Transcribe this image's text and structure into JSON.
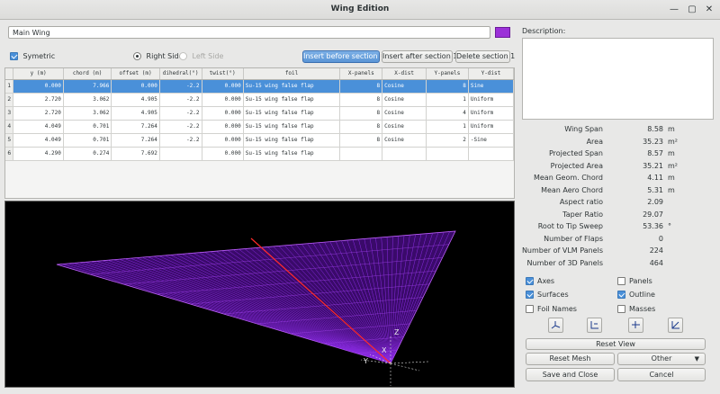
{
  "window": {
    "title": "Wing Edition",
    "minimize_glyph": "—",
    "maximize_glyph": "▢",
    "close_glyph": "✕"
  },
  "wing_name": "Main Wing",
  "wing_color": "#9b30d8",
  "symmetric": {
    "label": "Symetric",
    "checked": true
  },
  "side": {
    "right_label": "Right Side",
    "left_label": "Left Side",
    "selected": "right"
  },
  "buttons": {
    "insert_before": "Insert before section 1",
    "insert_after": "Insert after section 1",
    "delete_section": "Delete section 1",
    "reset_view": "Reset View",
    "reset_mesh": "Reset Mesh",
    "other": "Other",
    "save_close": "Save and Close",
    "cancel": "Cancel"
  },
  "table": {
    "columns": [
      "y (m)",
      "chord (m)",
      "offset (m)",
      "dihedral(°)",
      "twist(°)",
      "foil",
      "X-panels",
      "X-dist",
      "Y-panels",
      "Y-dist"
    ],
    "rows": [
      {
        "n": "1",
        "y": "0.000",
        "chord": "7.966",
        "offset": "0.000",
        "dihedral": "-2.2",
        "twist": "0.000",
        "foil": "Su-15 wing false flap",
        "xpanels": "8",
        "xdist": "Cosine",
        "ypanels": "8",
        "ydist": "Sine"
      },
      {
        "n": "2",
        "y": "2.720",
        "chord": "3.062",
        "offset": "4.905",
        "dihedral": "-2.2",
        "twist": "0.000",
        "foil": "Su-15 wing false flap",
        "xpanels": "8",
        "xdist": "Cosine",
        "ypanels": "1",
        "ydist": "Uniform"
      },
      {
        "n": "3",
        "y": "2.720",
        "chord": "3.062",
        "offset": "4.905",
        "dihedral": "-2.2",
        "twist": "0.000",
        "foil": "Su-15 wing false flap",
        "xpanels": "8",
        "xdist": "Cosine",
        "ypanels": "4",
        "ydist": "Uniform"
      },
      {
        "n": "4",
        "y": "4.049",
        "chord": "0.701",
        "offset": "7.264",
        "dihedral": "-2.2",
        "twist": "0.000",
        "foil": "Su-15 wing false flap",
        "xpanels": "8",
        "xdist": "Cosine",
        "ypanels": "1",
        "ydist": "Uniform"
      },
      {
        "n": "5",
        "y": "4.049",
        "chord": "0.701",
        "offset": "7.264",
        "dihedral": "-2.2",
        "twist": "0.000",
        "foil": "Su-15 wing false flap",
        "xpanels": "8",
        "xdist": "Cosine",
        "ypanels": "2",
        "ydist": "-Sine"
      },
      {
        "n": "6",
        "y": "4.290",
        "chord": "0.274",
        "offset": "7.692",
        "dihedral": "",
        "twist": "0.000",
        "foil": "Su-15 wing false flap",
        "xpanels": "",
        "xdist": "",
        "ypanels": "",
        "ydist": ""
      }
    ]
  },
  "view3d": {
    "axis_z": "Z",
    "axis_x": "X",
    "axis_y": "Y",
    "mesh_color": "#8a2be2",
    "highlight_color": "#ff2a2a"
  },
  "description_label": "Description:",
  "properties": [
    {
      "label": "Wing Span",
      "value": "8.58",
      "unit": "m"
    },
    {
      "label": "Area",
      "value": "35.23",
      "unit": "m²"
    },
    {
      "label": "Projected Span",
      "value": "8.57",
      "unit": "m"
    },
    {
      "label": "Projected Area",
      "value": "35.21",
      "unit": "m²"
    },
    {
      "label": "Mean Geom. Chord",
      "value": "4.11",
      "unit": "m"
    },
    {
      "label": "Mean Aero Chord",
      "value": "5.31",
      "unit": "m"
    },
    {
      "label": "Aspect ratio",
      "value": "2.09",
      "unit": ""
    },
    {
      "label": "Taper Ratio",
      "value": "29.07",
      "unit": ""
    },
    {
      "label": "Root to Tip Sweep",
      "value": "53.36",
      "unit": "°"
    },
    {
      "label": "Number of Flaps",
      "value": "0",
      "unit": ""
    },
    {
      "label": "Number of VLM Panels",
      "value": "224",
      "unit": ""
    },
    {
      "label": "Number of 3D Panels",
      "value": "464",
      "unit": ""
    }
  ],
  "display": {
    "axes": {
      "label": "Axes",
      "checked": true
    },
    "panels": {
      "label": "Panels",
      "checked": false
    },
    "surfaces": {
      "label": "Surfaces",
      "checked": true
    },
    "outline": {
      "label": "Outline",
      "checked": true
    },
    "foil_names": {
      "label": "Foil Names",
      "checked": false
    },
    "masses": {
      "label": "Masses",
      "checked": false
    }
  },
  "view_icons": [
    "view-iso-icon",
    "view-top-icon",
    "view-front-icon",
    "view-side-icon"
  ]
}
